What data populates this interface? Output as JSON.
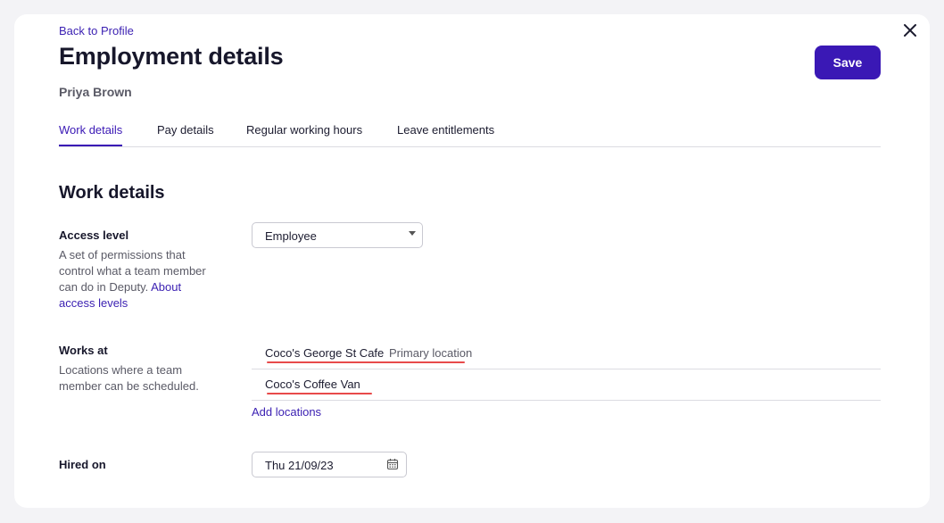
{
  "header": {
    "back_link": "Back to Profile",
    "title": "Employment details",
    "person_name": "Priya Brown",
    "save_label": "Save",
    "close_icon": "close-icon"
  },
  "tabs": [
    {
      "label": "Work details",
      "active": true
    },
    {
      "label": "Pay details",
      "active": false
    },
    {
      "label": "Regular working hours",
      "active": false
    },
    {
      "label": "Leave entitlements",
      "active": false
    }
  ],
  "section": {
    "title": "Work details"
  },
  "access_level": {
    "label": "Access level",
    "help_text": "A set of permissions that control what a team member can do in Deputy.",
    "help_link": "About access levels",
    "selected": "Employee"
  },
  "works_at": {
    "label": "Works at",
    "help_text": "Locations where a team member can be scheduled.",
    "locations": [
      {
        "name": "Coco's George St Cafe",
        "badge": "Primary location"
      },
      {
        "name": "Coco's Coffee Van",
        "badge": ""
      }
    ],
    "add_link": "Add locations"
  },
  "hired_on": {
    "label": "Hired on",
    "value": "Thu 21/09/23",
    "icon": "calendar-icon"
  },
  "colors": {
    "accent": "#3a18b5",
    "annotation": "#e84a4a"
  }
}
